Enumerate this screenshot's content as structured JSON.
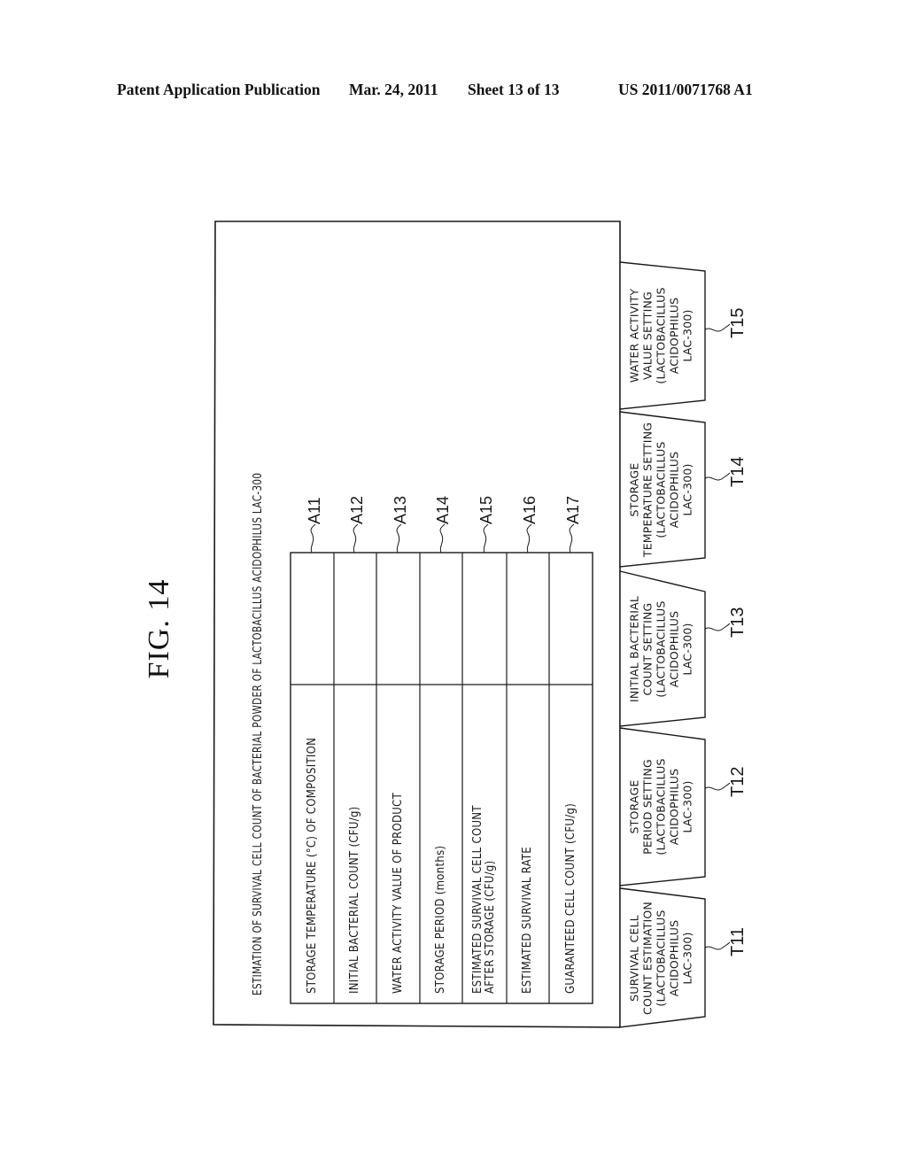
{
  "header": {
    "publication": "Patent Application Publication",
    "date": "Mar. 24, 2011",
    "sheet": "Sheet 13 of 13",
    "number": "US 2011/0071768 A1"
  },
  "figure": {
    "label": "FIG. 14"
  },
  "screen": {
    "title": "ESTIMATION OF SURVIVAL CELL COUNT OF BACTERIAL POWDER OF LACTOBACILLUS ACIDOPHILUS LAC-300",
    "rows": [
      {
        "label": [
          "STORAGE TEMPERATURE (°C) OF COMPOSITION"
        ],
        "value": "",
        "ref": "A11"
      },
      {
        "label": [
          "INITIAL BACTERIAL COUNT (CFU/g)"
        ],
        "value": "",
        "ref": "A12"
      },
      {
        "label": [
          "WATER ACTIVITY VALUE OF PRODUCT"
        ],
        "value": "",
        "ref": "A13"
      },
      {
        "label": [
          "STORAGE PERIOD (months)"
        ],
        "value": "",
        "ref": "A14"
      },
      {
        "label": [
          "ESTIMATED SURVIVAL CELL COUNT",
          "AFTER STORAGE (CFU/g)"
        ],
        "value": "",
        "ref": "A15"
      },
      {
        "label": [
          "ESTIMATED SURVIVAL RATE"
        ],
        "value": "",
        "ref": "A16"
      },
      {
        "label": [
          "GUARANTEED CELL COUNT (CFU/g)"
        ],
        "value": "",
        "ref": "A17"
      }
    ]
  },
  "tabs": [
    {
      "lines": [
        "SURVIVAL CELL",
        "COUNT ESTIMATION",
        "(LACTOBACILLUS",
        "ACIDOPHILUS",
        "LAC-300)"
      ],
      "ref": "T11"
    },
    {
      "lines": [
        "STORAGE",
        "PERIOD SETTING",
        "(LACTOBACILLUS",
        "ACIDOPHILUS",
        "LAC-300)"
      ],
      "ref": "T12"
    },
    {
      "lines": [
        "INITIAL BACTERIAL",
        "COUNT SETTING",
        "(LACTOBACILLUS",
        "ACIDOPHILUS",
        "LAC-300)"
      ],
      "ref": "T13"
    },
    {
      "lines": [
        "STORAGE",
        "TEMPERATURE SETTING",
        "(LACTOBACILLUS",
        "ACIDOPHILUS",
        "LAC-300)"
      ],
      "ref": "T14"
    },
    {
      "lines": [
        "WATER ACTIVITY",
        "VALUE SETTING",
        "(LACTOBACILLUS",
        "ACIDOPHILUS",
        "LAC-300)"
      ],
      "ref": "T15"
    }
  ]
}
